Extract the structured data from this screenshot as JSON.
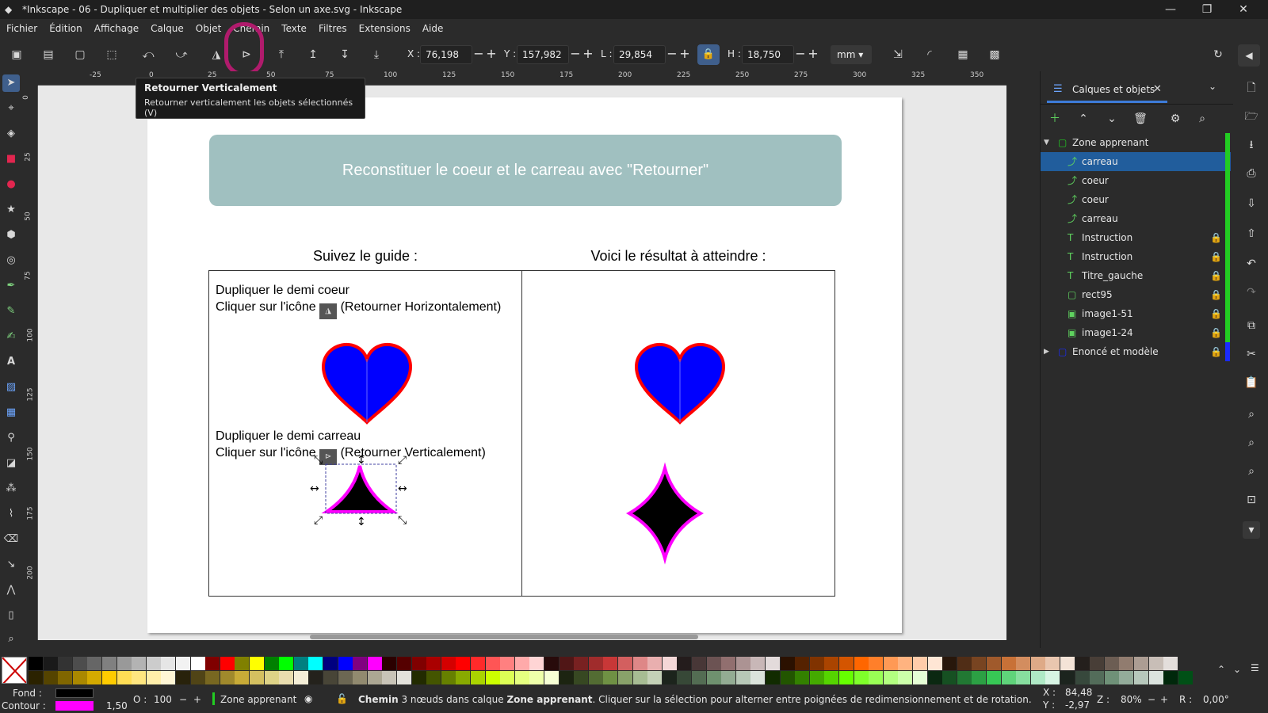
{
  "window": {
    "title": "*Inkscape - 06 - Dupliquer et multiplier des objets - Selon un axe.svg - Inkscape",
    "minimize": "—",
    "maximize": "❐",
    "close": "✕"
  },
  "menu": [
    "Fichier",
    "Édition",
    "Affichage",
    "Calque",
    "Objet",
    "Chemin",
    "Texte",
    "Filtres",
    "Extensions",
    "Aide"
  ],
  "toolbar": {
    "x_label": "X :",
    "x_value": "76,198",
    "y_label": "Y :",
    "y_value": "157,982",
    "w_label": "L :",
    "w_value": "29,854",
    "h_label": "H :",
    "h_value": "18,750",
    "unit": "mm",
    "minus": "−",
    "plus": "+"
  },
  "tooltip": {
    "title": "Retourner Verticalement",
    "text": "Retourner verticalement les objets sélectionnés (V)"
  },
  "ruler": {
    "h_labels": [
      "-25",
      "0",
      "25",
      "50",
      "75",
      "100",
      "125",
      "150",
      "175",
      "200",
      "225",
      "250",
      "275",
      "300",
      "325",
      "350"
    ],
    "v_labels": [
      "0",
      "25",
      "50",
      "75",
      "100",
      "125",
      "150",
      "175",
      "200"
    ]
  },
  "document": {
    "banner": "Reconstituer le coeur et le carreau avec \"Retourner\"",
    "left_title": "Suivez le guide :",
    "right_title": "Voici le résultat à atteindre :",
    "instr1_line1": "Dupliquer le demi coeur",
    "instr1_line2a": "Cliquer sur l'icône",
    "instr1_line2b": "(Retourner Horizontalement)",
    "instr2_line1": "Dupliquer le demi carreau",
    "instr2_line2a": "Cliquer sur l'icône",
    "instr2_line2b": "(Retourner Verticalement)"
  },
  "panel": {
    "tab_label": "Calques et objets",
    "tree": [
      {
        "label": "Zone apprenant",
        "type": "layer",
        "level": 0,
        "expanded": true,
        "locked": false,
        "selected": false,
        "color": "#22cc22"
      },
      {
        "label": "carreau",
        "type": "path",
        "level": 1,
        "locked": false,
        "selected": true,
        "color": "#22cc22"
      },
      {
        "label": "coeur",
        "type": "path",
        "level": 1,
        "locked": false,
        "selected": false,
        "color": "#22cc22"
      },
      {
        "label": "coeur",
        "type": "path",
        "level": 1,
        "locked": false,
        "selected": false,
        "color": "#22cc22"
      },
      {
        "label": "carreau",
        "type": "path",
        "level": 1,
        "locked": false,
        "selected": false,
        "color": "#22cc22"
      },
      {
        "label": "Instruction",
        "type": "text-box",
        "level": 1,
        "locked": true,
        "selected": false,
        "color": "#22cc22"
      },
      {
        "label": "Instruction",
        "type": "text-box",
        "level": 1,
        "locked": true,
        "selected": false,
        "color": "#22cc22"
      },
      {
        "label": "Titre_gauche",
        "type": "text",
        "level": 1,
        "locked": true,
        "selected": false,
        "color": "#22cc22"
      },
      {
        "label": "rect95",
        "type": "rect",
        "level": 1,
        "locked": true,
        "selected": false,
        "color": "#22cc22"
      },
      {
        "label": "image1-51",
        "type": "image",
        "level": 1,
        "locked": true,
        "selected": false,
        "color": "#22cc22"
      },
      {
        "label": "image1-24",
        "type": "image",
        "level": 1,
        "locked": true,
        "selected": false,
        "color": "#22cc22"
      },
      {
        "label": "Enoncé et modèle",
        "type": "layer",
        "level": 0,
        "expanded": false,
        "locked": true,
        "selected": false,
        "color": "#1a2bff"
      }
    ]
  },
  "status": {
    "fill_label": "Fond :",
    "stroke_label": "Contour :",
    "fill_color": "#000000",
    "stroke_color": "#ff00ff",
    "stroke_width": "1,50",
    "opacity_label": "O :",
    "opacity_value": "100",
    "layer": "Zone apprenant",
    "message_b1": "Chemin",
    "message_p1": " 3 nœuds dans calque ",
    "message_b2": "Zone apprenant",
    "message_p2": ". Cliquer sur la sélection pour alterner entre poignées de redimensionnement et de rotation.",
    "x_label": "X :",
    "x_value": "84,48",
    "y_label": "Y :",
    "y_value": "-2,97",
    "z_label": "Z :",
    "z_value": "80%",
    "r_label": "R :",
    "r_value": "0,00°"
  },
  "palette": [
    "#000000",
    "#1a1a1a",
    "#333333",
    "#4d4d4d",
    "#666666",
    "#808080",
    "#999999",
    "#b3b3b3",
    "#cccccc",
    "#e6e6e6",
    "#f2f2f2",
    "#ffffff",
    "#800000",
    "#ff0000",
    "#808000",
    "#ffff00",
    "#008000",
    "#00ff00",
    "#008080",
    "#00ffff",
    "#000080",
    "#0000ff",
    "#800080",
    "#ff00ff",
    "#2b0000",
    "#550000",
    "#800000",
    "#aa0000",
    "#d40000",
    "#ff0000",
    "#ff2a2a",
    "#ff5555",
    "#ff8080",
    "#ffaaaa",
    "#ffd5d5",
    "#280b0b",
    "#501616",
    "#782121",
    "#a02c2c",
    "#c83737",
    "#d35f5f",
    "#de8787",
    "#e9afaf",
    "#f4d7d7",
    "#241c1c",
    "#483737",
    "#6c5353",
    "#916f6f",
    "#ac9393",
    "#c8b7b7",
    "#e3dbdb",
    "#2b1100",
    "#552200",
    "#803300",
    "#aa4400",
    "#d45500",
    "#ff6600",
    "#ff7f2a",
    "#ff9955",
    "#ffb380",
    "#ffccaa",
    "#ffe6d5",
    "#28170b",
    "#502d16",
    "#784421",
    "#a05a2c",
    "#c87137",
    "#d38d5f",
    "#deaa87",
    "#e9c6af",
    "#f4e3d7",
    "#241f1c",
    "#483e37",
    "#6c5d53",
    "#917c6f",
    "#ac9d93",
    "#c8beb7",
    "#e3dedb"
  ],
  "palette2": [
    "#2b2200",
    "#554400",
    "#806600",
    "#aa8800",
    "#d4aa00",
    "#ffcc00",
    "#ffdd55",
    "#ffe680",
    "#ffeeaa",
    "#fff6d5",
    "#28220b",
    "#504416",
    "#786721",
    "#a0892c",
    "#c8ab37",
    "#d4c060",
    "#ded387",
    "#e9ddaf",
    "#f4eed7",
    "#24221c",
    "#484537",
    "#6c6753",
    "#918a6f",
    "#aca793",
    "#c8c4b7",
    "#e3e2db",
    "#222b00",
    "#445500",
    "#668000",
    "#88aa00",
    "#aad400",
    "#ccff00",
    "#ddff55",
    "#e5ff80",
    "#eeffaa",
    "#f6ffd5",
    "#1c2411",
    "#374822",
    "#536c33",
    "#6f9144",
    "#89a26a",
    "#a7bc93",
    "#c4d1b7",
    "#1c241c",
    "#374837",
    "#536c53",
    "#6f916f",
    "#93ac93",
    "#b7c8b7",
    "#dbe3db",
    "#112b00",
    "#225500",
    "#338000",
    "#44aa00",
    "#55d400",
    "#66ff00",
    "#7fff2a",
    "#99ff55",
    "#b3ff80",
    "#ccffaa",
    "#e5ffd5",
    "#0b2811",
    "#165022",
    "#217833",
    "#2ca044",
    "#37c855",
    "#5fd37a",
    "#87de9f",
    "#afe9c5",
    "#d7f4e3",
    "#1c241e",
    "#37483c",
    "#536c5a",
    "#6f9178",
    "#93ac9a",
    "#b7c8bc",
    "#dbe3de",
    "#00280b",
    "#005016"
  ]
}
